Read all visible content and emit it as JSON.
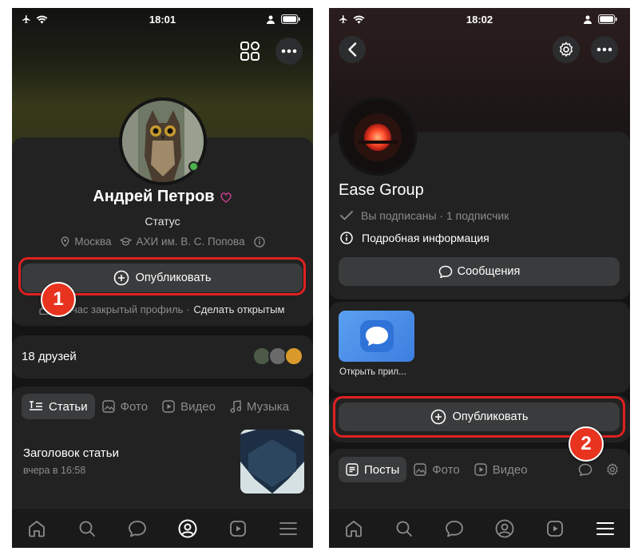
{
  "colors": {
    "accent_red": "#e02020",
    "badge_red": "#e8331f",
    "online": "#4bb34b",
    "bg": "#141414",
    "card": "#222222"
  },
  "screen1": {
    "status_time": "18:01",
    "profile": {
      "name": "Андрей Петров",
      "status": "Статус",
      "city": "Москва",
      "university": "АХИ им. В. С. Попова"
    },
    "publish_label": "Опубликовать",
    "private_profile_text": "Сейчас закрытый профиль ·",
    "make_open_link": "Сделать открытым",
    "friends_label": "18 друзей",
    "tabs": [
      "Статьи",
      "Фото",
      "Видео",
      "Музыка"
    ],
    "article": {
      "title": "Заголовок статьи",
      "time": "вчера в 16:58"
    },
    "step_badge": "1"
  },
  "screen2": {
    "status_time": "18:02",
    "group": {
      "name": "Ease Group",
      "subscription": "Вы подписаны · 1 подписчик",
      "details": "Подробная информация"
    },
    "messages_label": "Сообщения",
    "app_caption": "Открыть прил...",
    "publish_label": "Опубликовать",
    "tabs": [
      "Посты",
      "Фото",
      "Видео"
    ],
    "step_badge": "2"
  },
  "icons": [
    "airplane-icon",
    "wifi-icon",
    "person-icon",
    "battery-icon",
    "apps-grid-icon",
    "more-icon",
    "back-icon",
    "settings-icon",
    "location-icon",
    "education-icon",
    "info-icon",
    "plus-circle-icon",
    "lock-icon",
    "article-icon",
    "photo-icon",
    "video-icon",
    "music-icon",
    "check-icon",
    "message-icon",
    "posts-icon",
    "home-icon",
    "search-icon",
    "messenger-icon",
    "profile-icon",
    "clips-icon",
    "menu-icon"
  ]
}
